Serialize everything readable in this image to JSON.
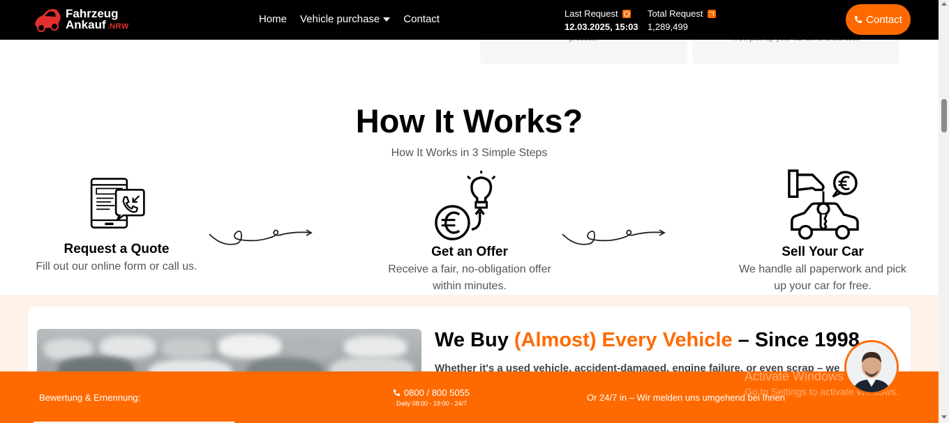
{
  "brand": {
    "line1": "Fahrzeug",
    "line2": "Ankauf",
    "suffix": ".NRW"
  },
  "nav": {
    "home": "Home",
    "vehicle_purchase": "Vehicle purchase",
    "contact": "Contact"
  },
  "stats": {
    "last_request_label": "Last Request",
    "last_request_value": "12.03.2025, 15:03",
    "total_request_label": "Total Request",
    "total_request_value": "1,289,499"
  },
  "contact_button": "Contact",
  "prev_cards": [
    "process.",
    "We'll pick up your car at no extra cost."
  ],
  "how_it_works": {
    "title": "How It Works?",
    "subtitle": "How It Works in 3 Simple Steps",
    "steps": [
      {
        "title": "Request a Quote",
        "desc_line1": "Fill out our online form or call us.",
        "desc_line2": ""
      },
      {
        "title": "Get an Offer",
        "desc_line1": "Receive a fair, no-obligation offer",
        "desc_line2": "within minutes."
      },
      {
        "title": "Sell Your Car",
        "desc_line1": "We handle all paperwork and pick",
        "desc_line2": "up your car for free."
      }
    ]
  },
  "buy_section": {
    "title_pre": "We Buy ",
    "title_highlight": "(Almost) Every Vehicle",
    "title_post": " – Since 1998",
    "text": "Whether it's a used vehicle, accident-damaged, engine failure, or even scrap – we"
  },
  "bottom_bar": {
    "left": "Bewertung & Ernennung:",
    "phone": "0800 / 800 5055",
    "hours": "Daily 08:00 - 19:00 - 24/7",
    "right": "Or 24/7 in – Wir melden uns umgehend bei Ihnen"
  },
  "os_watermark": {
    "line1": "Activate Windows",
    "line2": "Go to Settings to activate Windows."
  },
  "colors": {
    "accent": "#ff6a00",
    "navbar": "#000000",
    "peach": "#fdf1e8"
  }
}
